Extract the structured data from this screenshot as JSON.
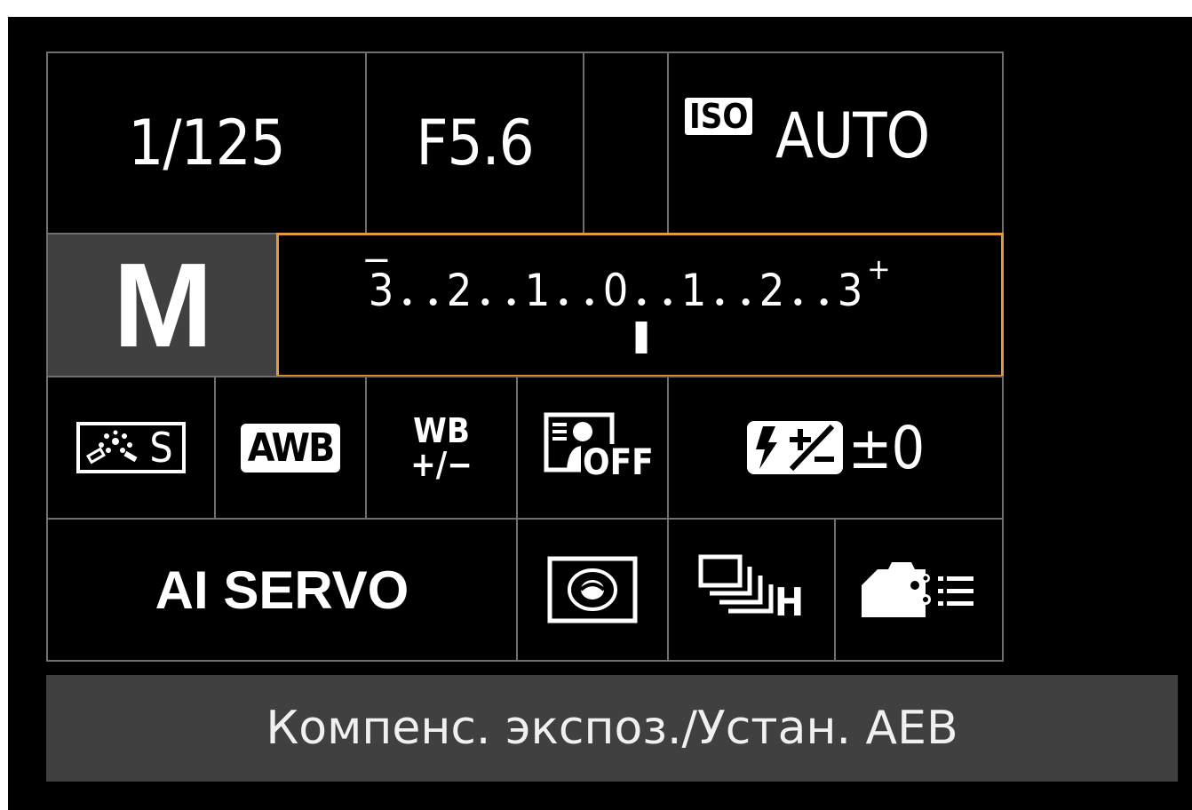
{
  "shooting": {
    "shutter_speed": "1/125",
    "aperture": "F5.6",
    "iso_badge": "ISO",
    "iso_value": "AUTO",
    "mode": "M",
    "exposure_scale_labels": [
      "3",
      "2",
      "1",
      "0",
      "1",
      "2",
      "3"
    ],
    "exposure_scale_minus": "−",
    "exposure_scale_plus": "+",
    "exposure_compensation": 0.33
  },
  "settings": {
    "picture_style_letter": "S",
    "white_balance": "AWB",
    "wb_shift_top": "WB",
    "wb_shift_bottom": "+/−",
    "auto_lighting_optimizer": "OFF",
    "flash_compensation": "±0",
    "af_mode": "AI SERVO",
    "drive_mode_letter": "H"
  },
  "status_text": "Компенс. экспоз./Устан. AEB",
  "icons": {
    "picture_style": "picture-style-icon",
    "white_balance": "awb-icon",
    "wb_shift": "wb-shift-icon",
    "alo": "auto-lighting-optimizer-icon",
    "flash_comp": "flash-exposure-comp-icon",
    "metering": "evaluative-metering-icon",
    "drive": "continuous-high-drive-icon",
    "custom_controls": "camera-custom-controls-icon"
  },
  "colors": {
    "selection": "#e29a3a",
    "grid": "#6f6f6f",
    "mode_bg": "#404040",
    "status_bg": "#404040"
  }
}
